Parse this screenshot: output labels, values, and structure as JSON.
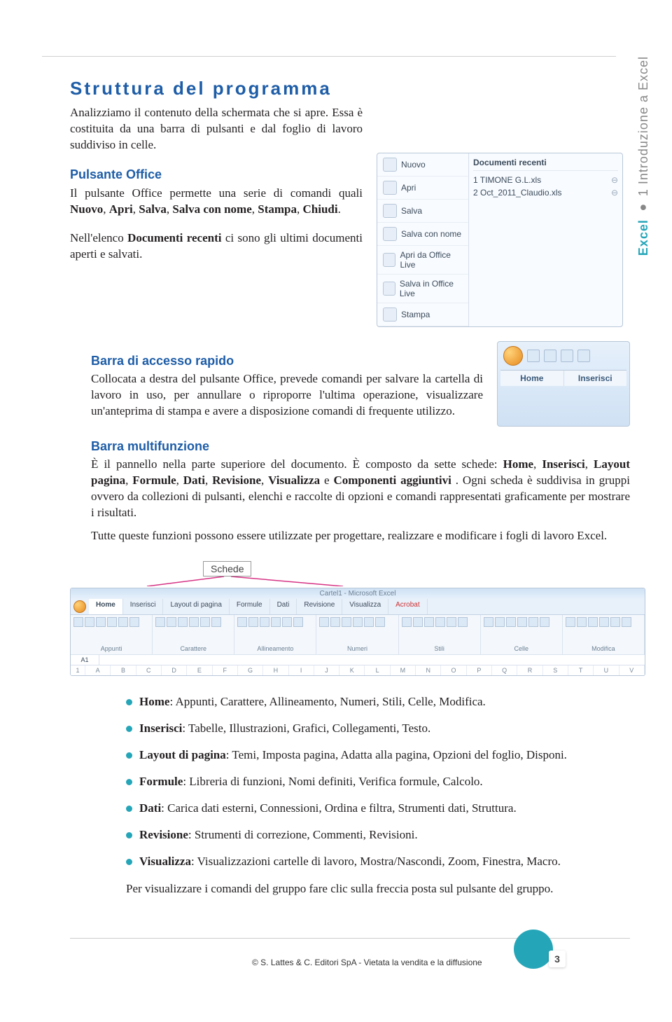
{
  "sideLabel": {
    "main": "Excel",
    "sep": "●",
    "sub": "1 Introduzione a Excel"
  },
  "title": "Struttura del programma",
  "intro": "Analizziamo il contenuto della schermata che si apre. Essa è costituita da una barra di pulsanti e dal foglio di lavoro suddiviso in celle.",
  "sec1": {
    "h": "Pulsante Office",
    "p1a": "Il pulsante Office permette una serie di comandi quali ",
    "p1b": "Nuovo",
    "p1c": ", ",
    "p1d": "Apri",
    "p1e": ", ",
    "p1f": "Salva",
    "p1g": ", ",
    "p1h": "Salva con nome",
    "p1i": ", ",
    "p1j": "Stampa",
    "p1k": ", ",
    "p1l": "Chiudi",
    "p1m": ".",
    "p2a": "Nell'elenco ",
    "p2b": "Documenti recenti",
    "p2c": " ci sono gli ultimi documenti aperti e salvati."
  },
  "officeMenu": {
    "items": [
      "Nuovo",
      "Apri",
      "Salva",
      "Salva con nome",
      "Apri da Office Live",
      "Salva in Office Live",
      "Stampa"
    ],
    "recentHeader": "Documenti recenti",
    "recents": [
      "1  TIMONE G.L.xls",
      "2  Oct_2011_Claudio.xls"
    ]
  },
  "sec2": {
    "h": "Barra di accesso rapido",
    "p": "Collocata a destra del pulsante Office, prevede comandi per salvare la cartella di lavoro in uso, per annullare o riproporre l'ultima operazione, visualizzare un'anteprima di stampa e avere a disposizione comandi di frequente utilizzo."
  },
  "qat": {
    "tabs": [
      "Home",
      "Inserisci"
    ]
  },
  "sec3": {
    "h": "Barra multifunzione",
    "p_a": "È il pannello nella parte superiore del documento. È composto da sette schede: ",
    "s1": "Home",
    "c1": ", ",
    "s2": "Inserisci",
    "c2": ", ",
    "s3": "Layout pagina",
    "c3": ", ",
    "s4": "Formule",
    "c4": ", ",
    "s5": "Dati",
    "c5": ", ",
    "s6": "Revisione",
    "c6": ", ",
    "s7": "Visualizza",
    "c7": " e ",
    "s8": "Componenti aggiuntivi",
    "p_b": ". Ogni scheda è suddivisa in gruppi ovvero da collezioni di pulsanti, elenchi e raccolte di opzioni e comandi rappresentati graficamente per mostrare i risultati.",
    "p2": "Tutte queste funzioni possono essere utilizzate per progettare, realizzare e modificare i fogli di lavoro Excel."
  },
  "callout": "Schede",
  "ribbon": {
    "title": "Cartel1 - Microsoft Excel",
    "tabs": [
      "Home",
      "Inserisci",
      "Layout di pagina",
      "Formule",
      "Dati",
      "Revisione",
      "Visualizza",
      "Acrobat"
    ],
    "groups": [
      "Appunti",
      "Carattere",
      "Allineamento",
      "Numeri",
      "Stili",
      "Celle",
      "Modifica"
    ],
    "cellRef": "A1",
    "cols": [
      "A",
      "B",
      "C",
      "D",
      "E",
      "F",
      "G",
      "H",
      "I",
      "J",
      "K",
      "L",
      "M",
      "N",
      "O",
      "P",
      "Q",
      "R",
      "S",
      "T",
      "U",
      "V"
    ]
  },
  "tabsList": [
    {
      "b": "Home",
      "t": ": Appunti, Carattere, Allineamento, Numeri, Stili, Celle, Modifica."
    },
    {
      "b": "Inserisci",
      "t": ": Tabelle, Illustrazioni, Grafici, Collegamenti, Testo."
    },
    {
      "b": "Layout di pagina",
      "t": ": Temi, Imposta pagina, Adatta alla pagina, Opzioni del foglio, Disponi."
    },
    {
      "b": "Formule",
      "t": ": Libreria di funzioni, Nomi definiti, Verifica formule, Calcolo."
    },
    {
      "b": "Dati",
      "t": ": Carica dati esterni, Connessioni, Ordina e filtra, Strumenti dati, Struttura."
    },
    {
      "b": "Revisione",
      "t": ": Strumenti di correzione, Commenti, Revisioni."
    },
    {
      "b": "Visualizza",
      "t": ": Visualizzazioni cartelle di lavoro, Mostra/Nascondi, Zoom, Finestra, Macro."
    }
  ],
  "closing": "Per visualizzare i comandi del gruppo fare clic sulla freccia posta sul pulsante del gruppo.",
  "footer": {
    "copyright": "© S. Lattes & C. Editori SpA - Vietata la vendita e la diffusione",
    "pageNum": "3"
  }
}
